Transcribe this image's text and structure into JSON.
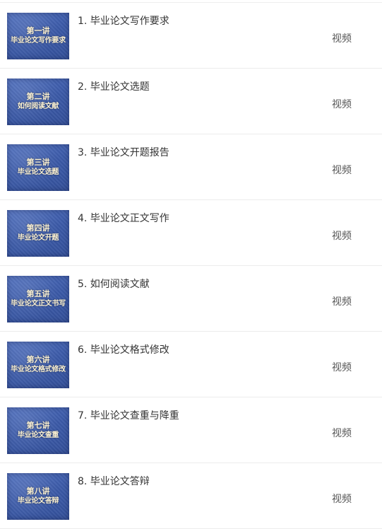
{
  "lessons": [
    {
      "thumb_line1": "第一讲",
      "thumb_line2": "毕业论文写作要求",
      "title": "1. 毕业论文写作要求",
      "tag": "视频"
    },
    {
      "thumb_line1": "第二讲",
      "thumb_line2": "如何阅读文献",
      "title": "2. 毕业论文选题",
      "tag": "视频"
    },
    {
      "thumb_line1": "第三讲",
      "thumb_line2": "毕业论文选题",
      "title": "3. 毕业论文开题报告",
      "tag": "视频"
    },
    {
      "thumb_line1": "第四讲",
      "thumb_line2": "毕业论文开题",
      "title": "4. 毕业论文正文写作",
      "tag": "视频"
    },
    {
      "thumb_line1": "第五讲",
      "thumb_line2": "毕业论文正文书写",
      "title": "5. 如何阅读文献",
      "tag": "视频"
    },
    {
      "thumb_line1": "第六讲",
      "thumb_line2": "毕业论文格式修改",
      "title": "6. 毕业论文格式修改",
      "tag": "视频"
    },
    {
      "thumb_line1": "第七讲",
      "thumb_line2": "毕业论文查重",
      "title": "7. 毕业论文查重与降重",
      "tag": "视频"
    },
    {
      "thumb_line1": "第八讲",
      "thumb_line2": "毕业论文答辩",
      "title": "8. 毕业论文答辩",
      "tag": "视频"
    }
  ]
}
